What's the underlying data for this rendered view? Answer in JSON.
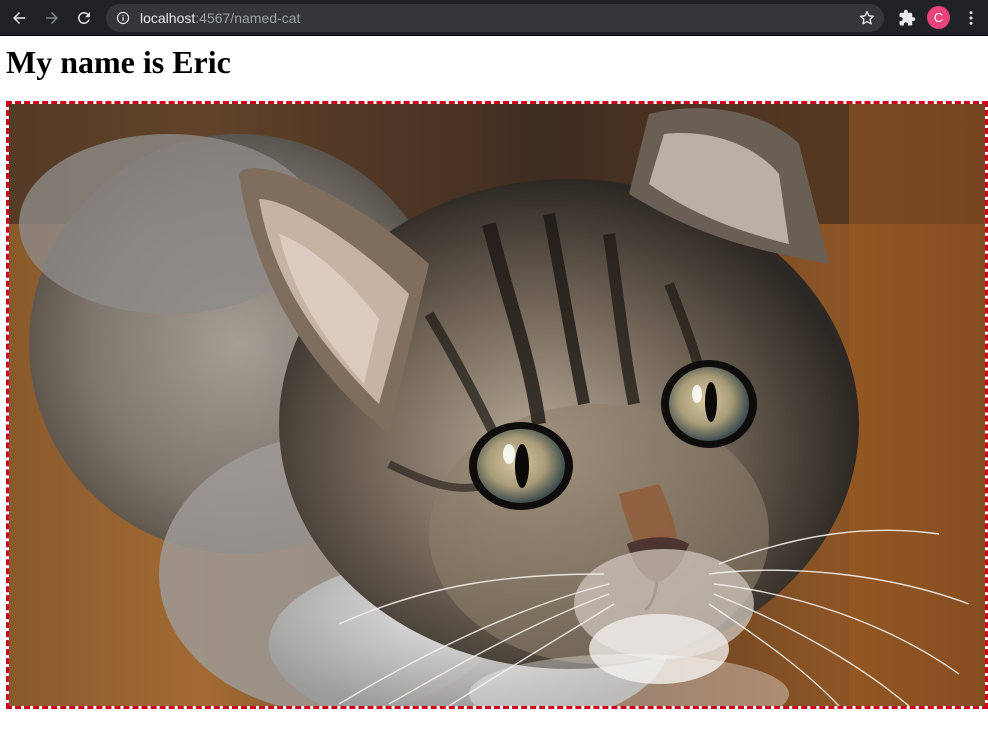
{
  "browser": {
    "url_host": "localhost",
    "url_rest": ":4567/named-cat",
    "profile_initial": "C",
    "icons": {
      "back": "arrow-left-icon",
      "forward": "arrow-right-icon",
      "reload": "reload-icon",
      "site_info": "info-icon",
      "bookmark": "star-icon",
      "extensions": "puzzle-icon",
      "menu": "kebab-menu-icon"
    },
    "colors": {
      "toolbar": "#202124",
      "omnibox": "#35363a",
      "profile": "#e8437a"
    }
  },
  "page": {
    "heading": "My name is Eric",
    "image": {
      "subject": "tabby kitten",
      "border_color": "#d0021b",
      "border_style": "dashed"
    }
  }
}
